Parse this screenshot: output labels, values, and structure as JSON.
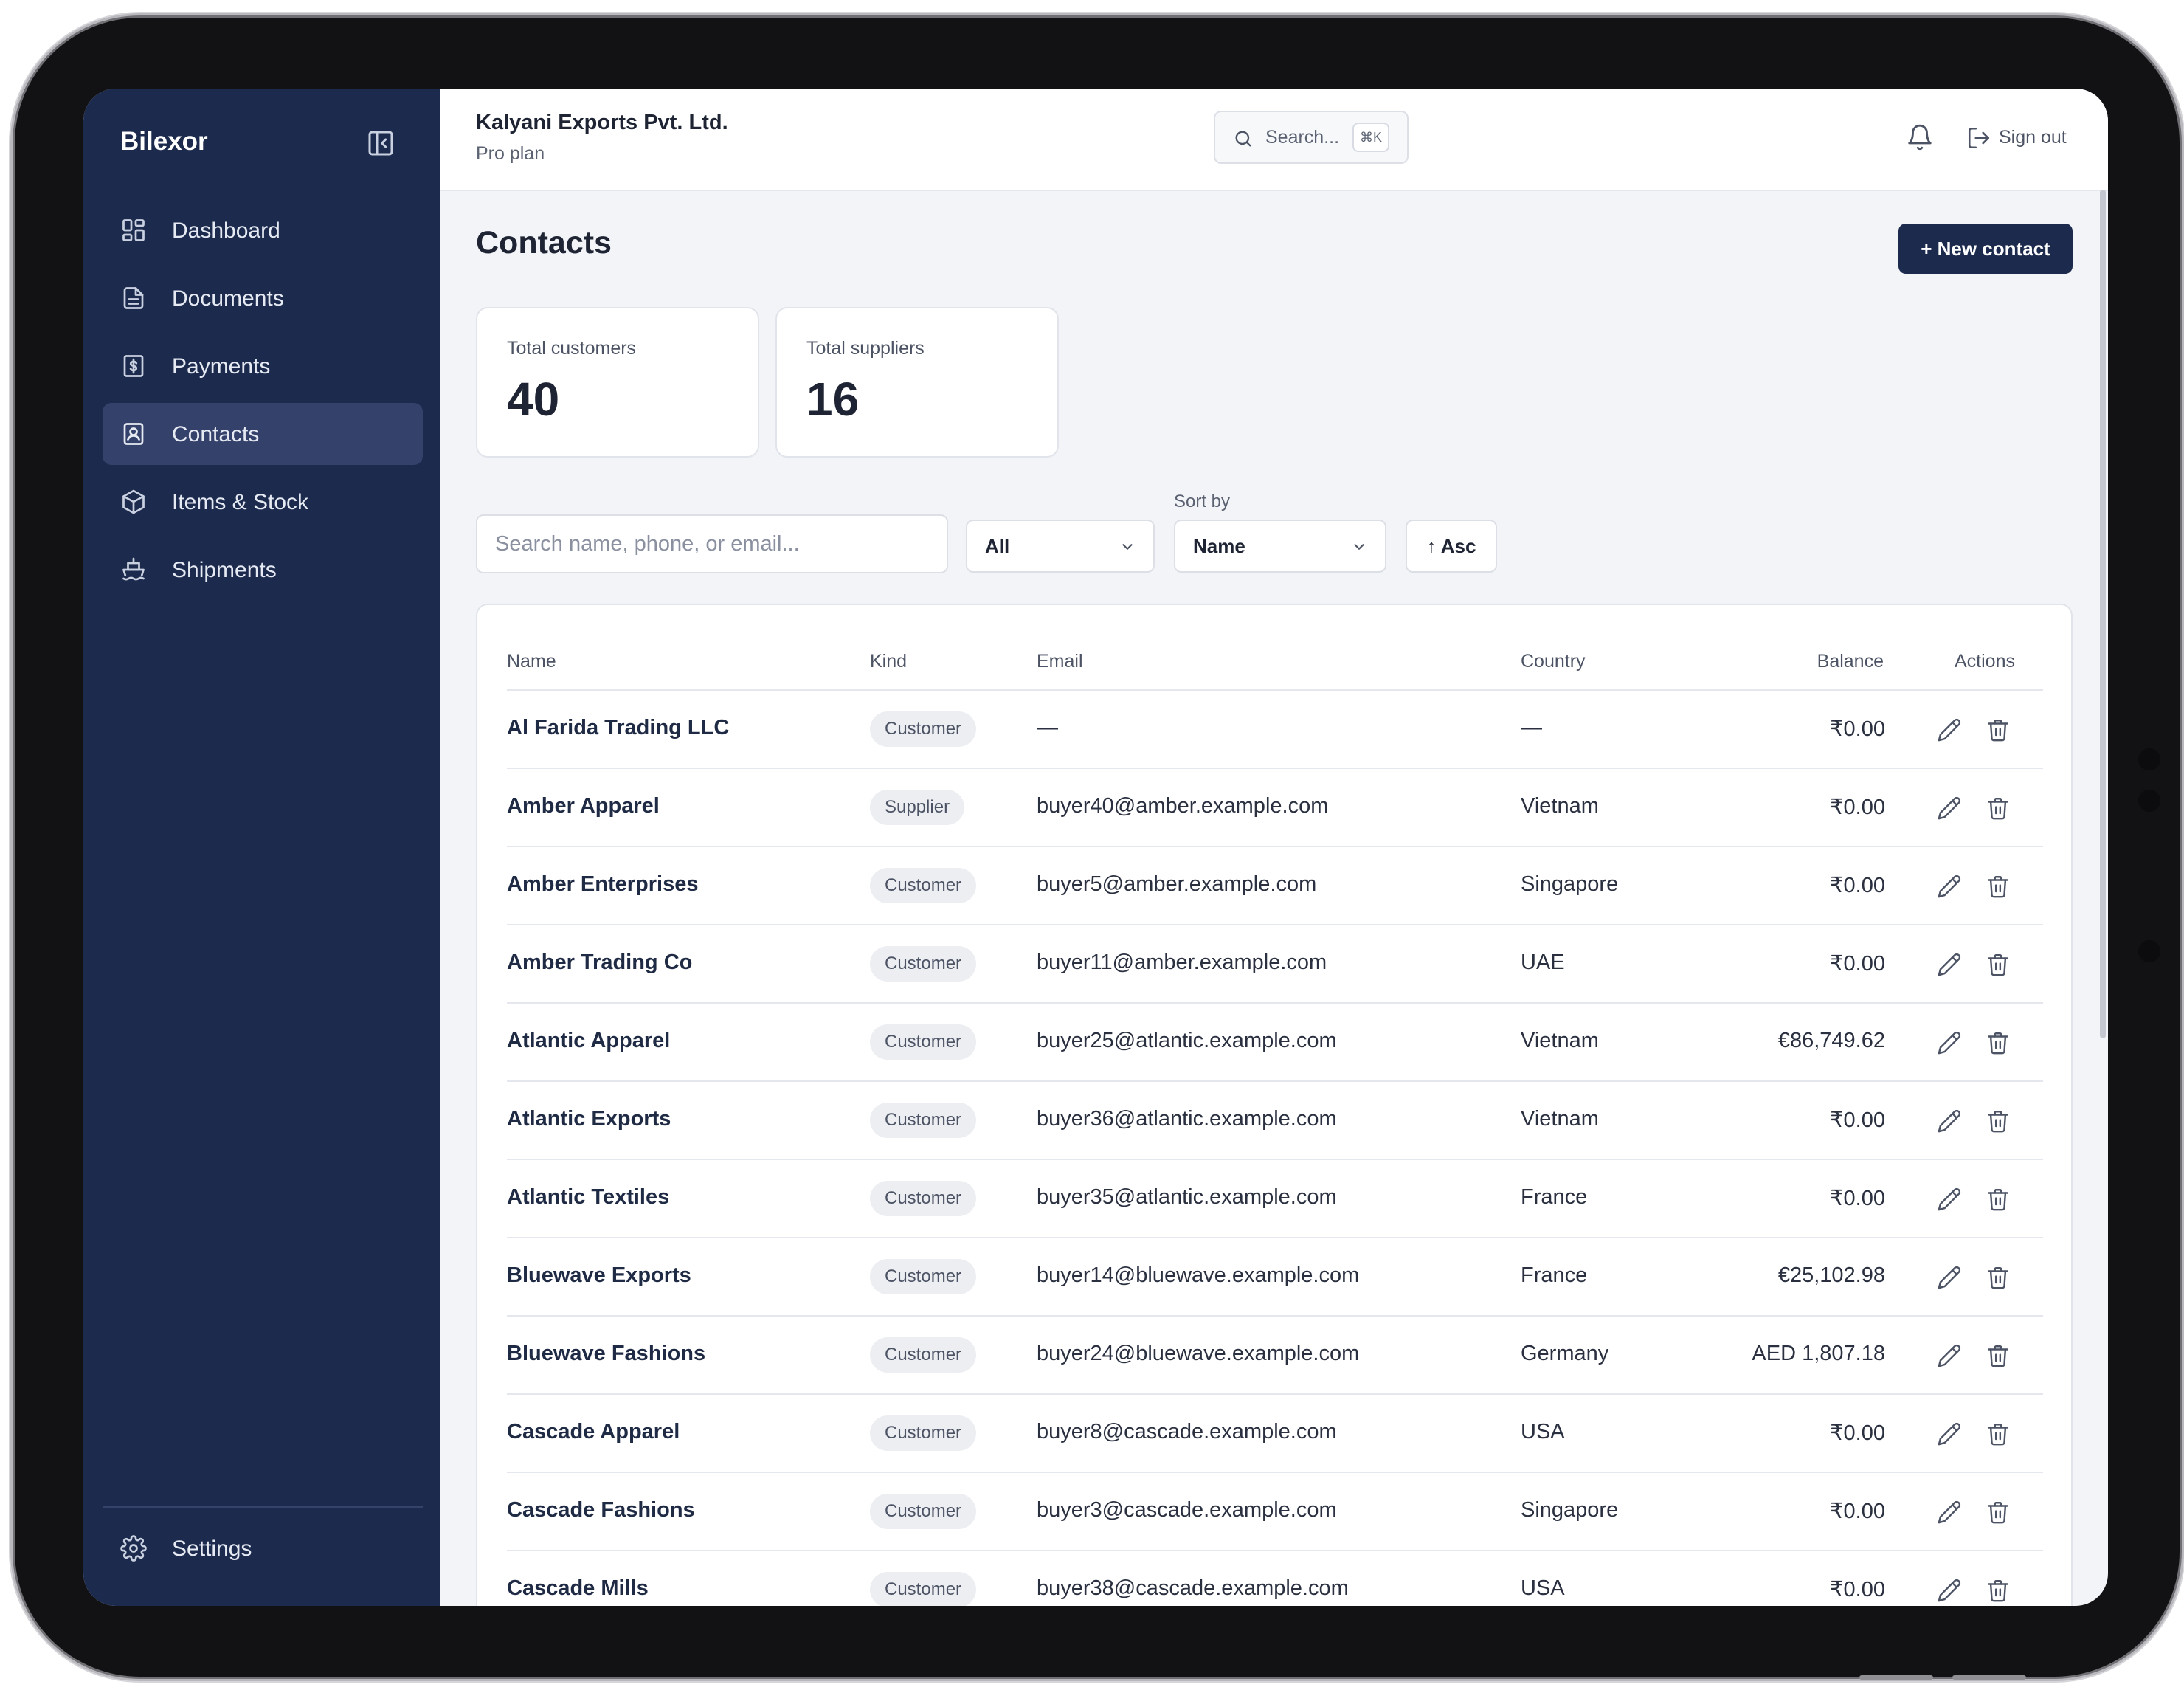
{
  "app": {
    "name": "Bilexor"
  },
  "sidebar": {
    "items": [
      {
        "label": "Dashboard",
        "icon": "dashboard-icon"
      },
      {
        "label": "Documents",
        "icon": "document-icon"
      },
      {
        "label": "Payments",
        "icon": "payments-icon"
      },
      {
        "label": "Contacts",
        "icon": "contacts-icon",
        "active": true
      },
      {
        "label": "Items & Stock",
        "icon": "box-icon"
      },
      {
        "label": "Shipments",
        "icon": "ship-icon"
      }
    ],
    "settings_label": "Settings"
  },
  "header": {
    "org_name": "Kalyani Exports Pvt. Ltd.",
    "plan": "Pro plan",
    "search_placeholder": "Search...",
    "search_shortcut": "⌘K",
    "signout_label": "Sign out"
  },
  "main": {
    "title": "Contacts",
    "new_button": "+ New contact",
    "stats": [
      {
        "label": "Total customers",
        "value": "40"
      },
      {
        "label": "Total suppliers",
        "value": "16"
      }
    ],
    "filters": {
      "search_placeholder": "Search name, phone, or email...",
      "kind_value": "All",
      "sort_label": "Sort by",
      "sort_value": "Name",
      "order_label": "↑ Asc"
    },
    "table": {
      "columns": [
        "Name",
        "Kind",
        "Email",
        "Country",
        "Balance",
        "Actions"
      ],
      "rows": [
        {
          "name": "Al Farida Trading LLC",
          "kind": "Customer",
          "email": "—",
          "country": "—",
          "balance": "₹0.00"
        },
        {
          "name": "Amber Apparel",
          "kind": "Supplier",
          "email": "buyer40@amber.example.com",
          "country": "Vietnam",
          "balance": "₹0.00"
        },
        {
          "name": "Amber Enterprises",
          "kind": "Customer",
          "email": "buyer5@amber.example.com",
          "country": "Singapore",
          "balance": "₹0.00"
        },
        {
          "name": "Amber Trading Co",
          "kind": "Customer",
          "email": "buyer11@amber.example.com",
          "country": "UAE",
          "balance": "₹0.00"
        },
        {
          "name": "Atlantic Apparel",
          "kind": "Customer",
          "email": "buyer25@atlantic.example.com",
          "country": "Vietnam",
          "balance": "€86,749.62"
        },
        {
          "name": "Atlantic Exports",
          "kind": "Customer",
          "email": "buyer36@atlantic.example.com",
          "country": "Vietnam",
          "balance": "₹0.00"
        },
        {
          "name": "Atlantic Textiles",
          "kind": "Customer",
          "email": "buyer35@atlantic.example.com",
          "country": "France",
          "balance": "₹0.00"
        },
        {
          "name": "Bluewave Exports",
          "kind": "Customer",
          "email": "buyer14@bluewave.example.com",
          "country": "France",
          "balance": "€25,102.98"
        },
        {
          "name": "Bluewave Fashions",
          "kind": "Customer",
          "email": "buyer24@bluewave.example.com",
          "country": "Germany",
          "balance": "AED 1,807.18"
        },
        {
          "name": "Cascade Apparel",
          "kind": "Customer",
          "email": "buyer8@cascade.example.com",
          "country": "USA",
          "balance": "₹0.00"
        },
        {
          "name": "Cascade Fashions",
          "kind": "Customer",
          "email": "buyer3@cascade.example.com",
          "country": "Singapore",
          "balance": "₹0.00"
        },
        {
          "name": "Cascade Mills",
          "kind": "Customer",
          "email": "buyer38@cascade.example.com",
          "country": "USA",
          "balance": "₹0.00"
        }
      ]
    }
  },
  "colors": {
    "sidebar": "#1c2a4d",
    "active": "#34416a",
    "primary_button": "#1c2a4d",
    "page_bg": "#f3f4f8"
  }
}
